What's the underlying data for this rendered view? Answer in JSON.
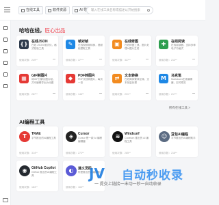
{
  "topbar": {
    "tabs": [
      {
        "label": "在线工具"
      },
      {
        "label": "软件资源"
      },
      {
        "label": "AI 导航"
      }
    ],
    "search_placeholder": "输入在线工具名称或描述以开始搜索"
  },
  "section1": {
    "title": "哈哈在线，",
    "title_accent": "匠心出品",
    "more_link": "所有在线工具 >",
    "cards": [
      {
        "name": "在线JSON",
        "desc": "在线 JSON 格式化，格式校验工具",
        "visits": "使用次数：249**",
        "logo": "{}",
        "color": "#2d3a4b"
      },
      {
        "name": "帧对帧",
        "desc": "在线视频帧转换，视频帧提取工具",
        "visits": "使用次数：37***",
        "logo": "✎",
        "color": "#1e88e5"
      },
      {
        "name": "在线修图",
        "desc": "在线修图工具，图片处理AI图片生成",
        "visits": "使用次数：327**",
        "logo": "▣",
        "color": "#f28b20"
      },
      {
        "name": "在线阅读",
        "desc": "在线阅读器，支持多种电子书格式",
        "visits": "使用次数：213**",
        "logo": "✚",
        "color": "#2e9e4f"
      },
      {
        "name": "GIF制图片",
        "desc": "将GIF分解为图片帧，并可编辑导出为动图",
        "visits": "使用次数：287**",
        "logo": "▦",
        "color": "#e53935"
      },
      {
        "name": "PDF转图片",
        "desc": "PDF文档转图片，每页一张",
        "visits": "使用次数：146**",
        "logo": "◆",
        "color": "#e53935"
      },
      {
        "name": "文本转换",
        "desc": "在线简体繁体互转，文本批量处理",
        "visits": "使用次数：231**",
        "logo": "⇄",
        "color": "#f28b20"
      },
      {
        "name": "马克笔",
        "desc": "Markdown在线编辑器，实时预览",
        "visits": "使用次数：217**",
        "logo": "M",
        "color": "#1e88e5"
      }
    ]
  },
  "section2": {
    "title": "AI编程工具",
    "cards": [
      {
        "name": "TRAE",
        "desc": "字节推出的AI编程工具",
        "visits": "使用次数：314**",
        "logo": "T",
        "color": "#e53935"
      },
      {
        "name": "Cursor",
        "desc": "Cursor 是一款 AI 编程编辑器",
        "visits": "使用次数：272**",
        "logo": "◈",
        "color": "#222222"
      },
      {
        "name": "Windsurf",
        "desc": "Codeium 推出的 AI 编程工具",
        "visits": "使用次数：285**",
        "logo": "≋",
        "color": "#111111"
      },
      {
        "name": "豆包AI编程",
        "desc": "字节推出的AI编程助手",
        "visits": "使用次数：216**",
        "logo": "☺",
        "color": "#5b6b82"
      },
      {
        "name": "GitHub Copilot",
        "desc": "GitHub 推出的AI编程工具",
        "visits": "使用次数：184**",
        "logo": "◉",
        "color": "#24292f"
      },
      {
        "name": "通义灵码",
        "desc": "阿里推出的AI编程助手",
        "visits": "使用次数：163**",
        "logo": "◐",
        "color": "#5b5bd6"
      }
    ]
  },
  "watermark": {
    "logo": "JV",
    "title": "自动秒收录",
    "subtitle": "一 提交上链接一未动一秒一自动收录"
  }
}
